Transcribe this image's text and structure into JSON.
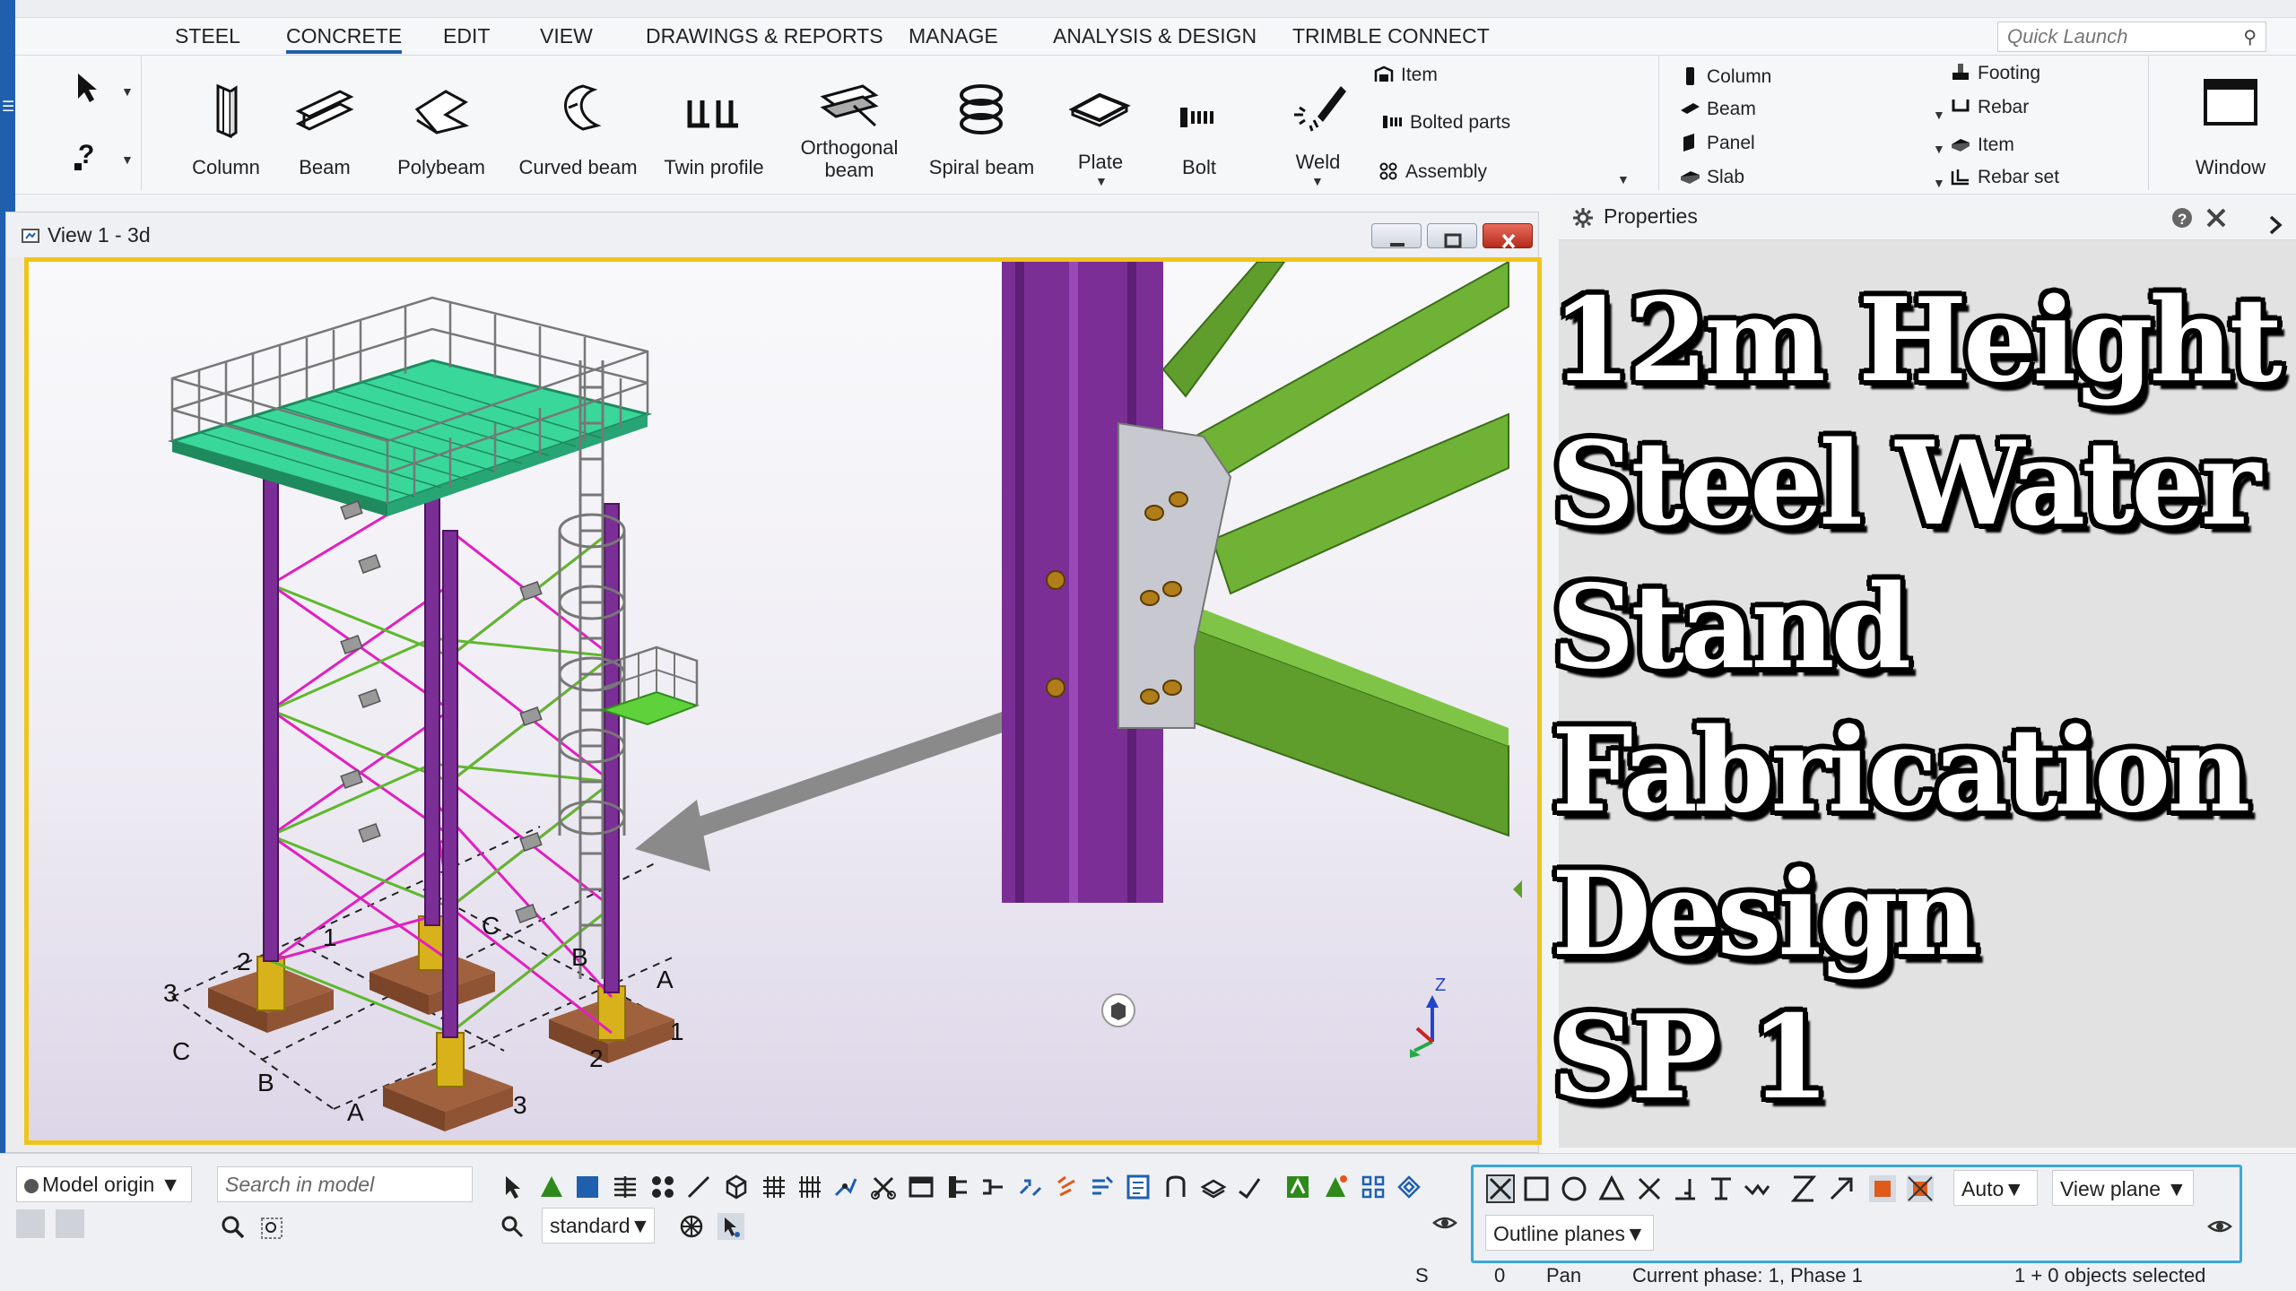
{
  "menu": {
    "tabs": [
      "STEEL",
      "CONCRETE",
      "EDIT",
      "VIEW",
      "DRAWINGS & REPORTS",
      "MANAGE",
      "ANALYSIS & DESIGN",
      "TRIMBLE CONNECT"
    ],
    "active": "CONCRETE",
    "quick_launch_placeholder": "Quick Launch"
  },
  "ribbon": {
    "steel_tools": [
      "Column",
      "Beam",
      "Polybeam",
      "Curved beam",
      "Twin profile",
      "Orthogonal beam",
      "Spiral beam",
      "Plate",
      "Bolt",
      "Weld"
    ],
    "part_group": [
      "Item",
      "Bolted parts",
      "Assembly"
    ],
    "concrete_group": [
      "Column",
      "Beam",
      "Panel",
      "Slab"
    ],
    "rebar_group": [
      "Footing",
      "Rebar",
      "Item",
      "Rebar set"
    ],
    "window_label": "Window"
  },
  "view": {
    "title": "View 1 - 3d"
  },
  "properties": {
    "title": "Properties"
  },
  "overlay": {
    "lines": [
      "12m Height",
      "Steel Water",
      "Stand",
      "Fabrication",
      "Design",
      "SP 1"
    ]
  },
  "model_labels": [
    "1",
    "2",
    "3",
    "C",
    "B",
    "A",
    "C",
    "B",
    "A",
    "1",
    "2",
    "3"
  ],
  "axis_labels": {
    "z": "Z"
  },
  "bottom": {
    "model_origin": "Model origin",
    "search_placeholder": "Search in model",
    "standard": "standard",
    "auto": "Auto",
    "view_plane": "View plane",
    "outline_planes": "Outline planes"
  },
  "status": {
    "snap": "S",
    "count": "0",
    "mode": "Pan",
    "phase": "Current phase: 1, Phase 1",
    "selected": "1 + 0 objects selected"
  },
  "colors": {
    "accent": "#1f5fae",
    "selection_frame": "#f0c419",
    "column": "#7b2e96",
    "brace": "#e020c0",
    "member": "#5f9e2c",
    "grating": "#3ad79a"
  }
}
